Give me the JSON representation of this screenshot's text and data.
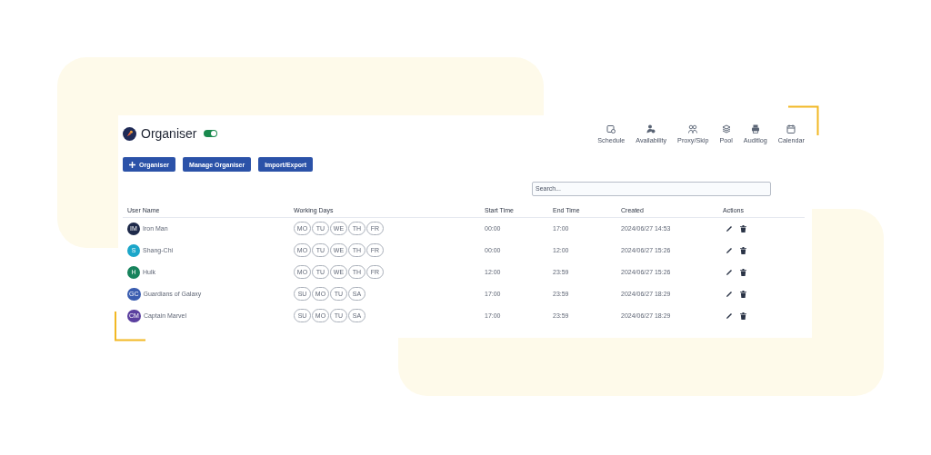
{
  "app": {
    "title": "Organiser",
    "enabled": true
  },
  "nav": [
    {
      "label": "Schedule",
      "kind": "schedule"
    },
    {
      "label": "Availability",
      "kind": "availability"
    },
    {
      "label": "Proxy/Skip",
      "kind": "proxy"
    },
    {
      "label": "Pool",
      "kind": "pool"
    },
    {
      "label": "Auditlog",
      "kind": "auditlog"
    },
    {
      "label": "Calendar",
      "kind": "calendar"
    }
  ],
  "buttons": [
    {
      "label": "Organiser",
      "kind": "add"
    },
    {
      "label": "Manage Organiser",
      "kind": "plain"
    },
    {
      "label": "Import/Export",
      "kind": "plain"
    }
  ],
  "search": {
    "placeholder": "Search..."
  },
  "table": {
    "columns": [
      "User Name",
      "Working Days",
      "Start Time",
      "End Time",
      "Created",
      "Actions"
    ],
    "rows": [
      {
        "initials": "IM",
        "color": "#1e2a4a",
        "name": "Iron Man",
        "days": [
          "MO",
          "TU",
          "WE",
          "TH",
          "FR"
        ],
        "start": "00:00",
        "end": "17:00",
        "created": "2024/06/27 14:53"
      },
      {
        "initials": "S",
        "color": "#1ba6c9",
        "name": "Shang-Chi",
        "days": [
          "MO",
          "TU",
          "WE",
          "TH",
          "FR"
        ],
        "start": "00:00",
        "end": "12:00",
        "created": "2024/06/27 15:26"
      },
      {
        "initials": "H",
        "color": "#17835c",
        "name": "Hulk",
        "days": [
          "MO",
          "TU",
          "WE",
          "TH",
          "FR"
        ],
        "start": "12:00",
        "end": "23:59",
        "created": "2024/06/27 15:26"
      },
      {
        "initials": "GC",
        "color": "#3a5db0",
        "name": "Guardians of Galaxy",
        "days": [
          "SU",
          "MO",
          "TU",
          "SA"
        ],
        "start": "17:00",
        "end": "23:59",
        "created": "2024/06/27 18:29"
      },
      {
        "initials": "CM",
        "color": "#5b3f9f",
        "name": "Captain Marvel",
        "days": [
          "SU",
          "MO",
          "TU",
          "SA"
        ],
        "start": "17:00",
        "end": "23:59",
        "created": "2024/06/27 18:29"
      }
    ]
  }
}
